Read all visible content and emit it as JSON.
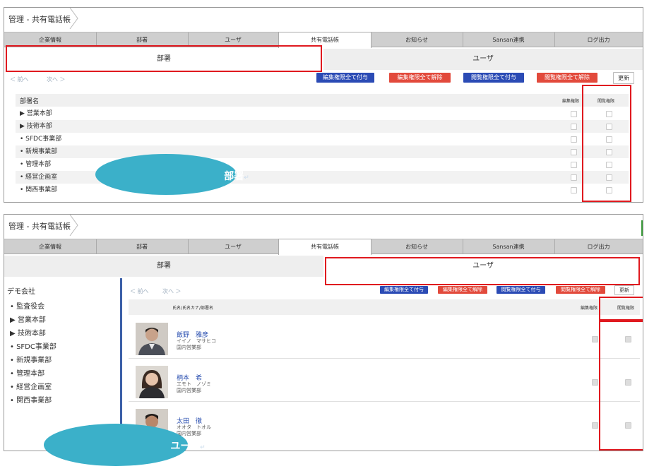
{
  "breadcrumb": "管理 - 共有電話帳",
  "tabs": [
    "企業情報",
    "部署",
    "ユーザ",
    "共有電話帳",
    "お知らせ",
    "Sansan連携",
    "ログ出力"
  ],
  "active_tab": "共有電話帳",
  "subtabs": {
    "dept": "部署",
    "user": "ユーザ"
  },
  "pager": {
    "prev": "＜ 前へ",
    "next": "次へ ＞"
  },
  "buttons": {
    "edit_grant": "編集権限全て付与",
    "edit_revoke": "編集権限全て解除",
    "view_grant": "閲覧権限全て付与",
    "view_revoke": "閲覧権限全て解除",
    "refresh": "更新"
  },
  "dept_table": {
    "header_name": "部署名",
    "header_edit": "編集権限",
    "header_view": "閲覧権限",
    "rows": [
      "▶ 営業本部",
      "▶ 技術本部",
      "• SFDC事業部",
      "• 新規事業部",
      "• 管理本部",
      "• 経営企画室",
      "• 関西事業部"
    ]
  },
  "callout_dept": "部署",
  "company": "デモ会社",
  "sidebar_items": [
    "• 監査役会",
    "▶ 営業本部",
    "▶ 技術本部",
    "• SFDC事業部",
    "• 新規事業部",
    "• 管理本部",
    "• 経営企画室",
    "• 関西事業部"
  ],
  "user_table": {
    "header_name": "氏名/氏名カナ/部署名",
    "header_edit": "編集権限",
    "header_view": "閲覧権限",
    "users": [
      {
        "name": "飯野　雅彦",
        "kana": "イイノ　マサヒコ",
        "dept": "国内営業部"
      },
      {
        "name": "柄本　希",
        "kana": "エモト　ノゾミ",
        "dept": "国内営業部"
      },
      {
        "name": "太田　徹",
        "kana": "オオタ　トオル",
        "dept": "国内営業部"
      }
    ]
  },
  "callout_user": "ユーザ",
  "return_mark": "↵",
  "colors": {
    "accent_blue": "#2b4bb5",
    "accent_red": "#e24a3c",
    "callout": "#3bb0c9",
    "highlight": "#e0191f"
  }
}
